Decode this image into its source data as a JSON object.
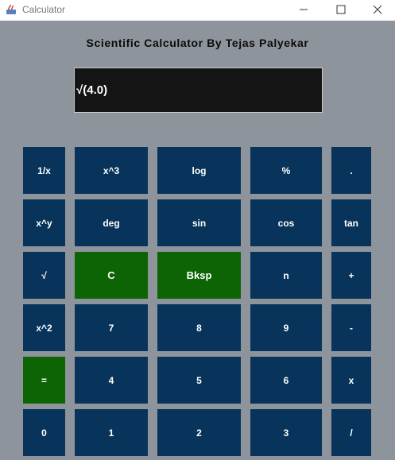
{
  "window": {
    "title": "Calculator"
  },
  "heading": "Scientific Calculator By Tejas Palyekar",
  "display": {
    "value": "√(4.0)"
  },
  "keys": {
    "reciprocal": "1/x",
    "cube": "x^3",
    "log": "log",
    "percent": "%",
    "dot": ".",
    "power": "x^y",
    "deg": "deg",
    "sin": "sin",
    "cos": "cos",
    "tan": "tan",
    "sqrt": "√",
    "clear": "C",
    "backspace": "Bksp",
    "n": "n",
    "plus": "+",
    "square": "x^2",
    "seven": "7",
    "eight": "8",
    "nine": "9",
    "minus": "-",
    "equals": "=",
    "four": "4",
    "five": "5",
    "six": "6",
    "multiply": "x",
    "zero": "0",
    "one": "1",
    "two": "2",
    "three": "3",
    "divide": "/"
  },
  "colors": {
    "key": "#08345b",
    "key_accent": "#0d6404",
    "display_bg": "#141414",
    "window_bg": "#8e949b"
  }
}
